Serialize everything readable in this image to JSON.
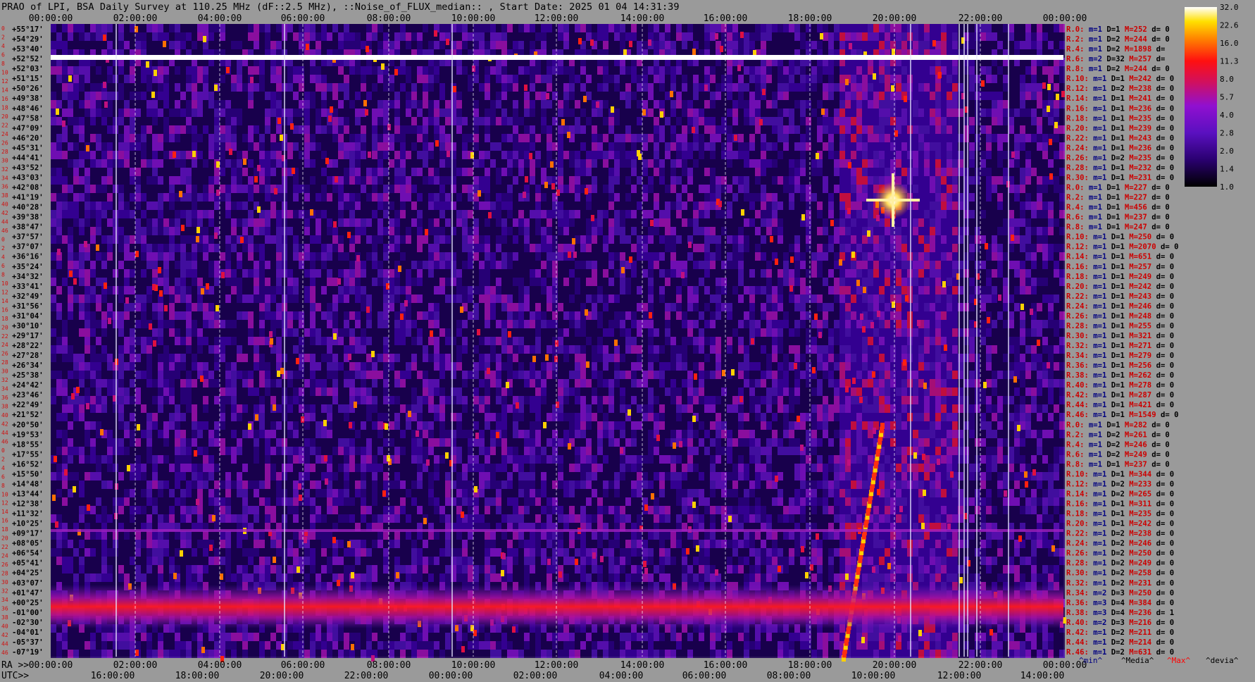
{
  "title": "PRAO of LPI, BSA Daily Survey at 110.25 MHz (dF::2.5 MHz), ::Noise_of_FLUX_median:: , Start Date: 2025 01 04 14:31:39",
  "chart_data": {
    "type": "heatmap",
    "title": "PRAO of LPI, BSA Daily Survey at 110.25 MHz (dF::2.5 MHz), ::Noise_of_FLUX_median:: , Start Date: 2025 01 04 14:31:39",
    "x_top_ticks": [
      "00:00:00",
      "02:00:00",
      "04:00:00",
      "06:00:00",
      "08:00:00",
      "10:00:00",
      "12:00:00",
      "14:00:00",
      "16:00:00",
      "18:00:00",
      "20:00:00",
      "22:00:00",
      "00:00:00"
    ],
    "x_ra_label": "RA >>",
    "x_ra_ticks": [
      "00:00:00",
      "02:00:00",
      "04:00:00",
      "06:00:00",
      "08:00:00",
      "10:00:00",
      "12:00:00",
      "14:00:00",
      "16:00:00",
      "18:00:00",
      "20:00:00",
      "22:00:00",
      "00:00:00"
    ],
    "x_utc_label": "UTC>>",
    "x_utc_ticks": [
      "16:00:00",
      "18:00:00",
      "20:00:00",
      "22:00:00",
      "00:00:00",
      "02:00:00",
      "04:00:00",
      "06:00:00",
      "08:00:00",
      "10:00:00",
      "12:00:00",
      "14:00:00"
    ],
    "row_index_labels": [
      "0",
      "2",
      "4",
      "6",
      "8",
      "10",
      "12",
      "14",
      "16",
      "18",
      "20",
      "22",
      "24",
      "26",
      "28",
      "30",
      "32",
      "34",
      "36",
      "38",
      "40",
      "42",
      "44",
      "46",
      "0",
      "2",
      "4",
      "6",
      "8",
      "10",
      "12",
      "14",
      "16",
      "18",
      "20",
      "22",
      "24",
      "26",
      "28",
      "30",
      "32",
      "34",
      "36",
      "38",
      "40",
      "42",
      "44",
      "46",
      "0",
      "2",
      "4",
      "6",
      "8",
      "10",
      "12",
      "14",
      "16",
      "18",
      "20",
      "22",
      "24",
      "26",
      "28",
      "30",
      "32",
      "34",
      "36",
      "38",
      "40",
      "42",
      "44",
      "46"
    ],
    "declination_labels": [
      "+55°17'",
      "+54°29'",
      "+53°40'",
      "+52°52'",
      "+52°03'",
      "+51°15'",
      "+50°26'",
      "+49°38'",
      "+48°46'",
      "+47°58'",
      "+47°09'",
      "+46°20'",
      "+45°31'",
      "+44°41'",
      "+43°52'",
      "+43°03'",
      "+42°08'",
      "+41°19'",
      "+40°28'",
      "+39°38'",
      "+38°47'",
      "+37°57'",
      "+37°07'",
      "+36°16'",
      "+35°24'",
      "+34°32'",
      "+33°41'",
      "+32°49'",
      "+31°56'",
      "+31°04'",
      "+30°10'",
      "+29°17'",
      "+28°22'",
      "+27°28'",
      "+26°34'",
      "+25°38'",
      "+24°42'",
      "+23°46'",
      "+22°49'",
      "+21°52'",
      "+20°50'",
      "+19°53'",
      "+18°55'",
      "+17°55'",
      "+16°52'",
      "+15°50'",
      "+14°48'",
      "+13°44'",
      "+12°38'",
      "+11°32'",
      "+10°25'",
      "+09°17'",
      "+08°05'",
      "+06°54'",
      "+05°41'",
      "+04°25'",
      "+03°07'",
      "+01°47'",
      "+00°25'",
      "-01°00'",
      "-02°30'",
      "-04°01'",
      "-05°37'",
      "-07°19'"
    ],
    "receiver_stats": [
      {
        "r": "R.0:",
        "m": "m=1",
        "D": "D=1",
        "M": "M=252",
        "d": "d= 0"
      },
      {
        "r": "R.2:",
        "m": "m=1",
        "D": "D=2",
        "M": "M=244",
        "d": "d= 0"
      },
      {
        "r": "R.4:",
        "m": "m=1",
        "D": "D=2",
        "M": "M=1898",
        "d": "d="
      },
      {
        "r": "R.6:",
        "m": "m=2",
        "D": "D=32",
        "M": "M=257",
        "d": "d="
      },
      {
        "r": "R.8:",
        "m": "m=1",
        "D": "D=2",
        "M": "M=244",
        "d": "d= 0"
      },
      {
        "r": "R.10:",
        "m": "m=1",
        "D": "D=1",
        "M": "M=242",
        "d": "d= 0"
      },
      {
        "r": "R.12:",
        "m": "m=1",
        "D": "D=2",
        "M": "M=238",
        "d": "d= 0"
      },
      {
        "r": "R.14:",
        "m": "m=1",
        "D": "D=1",
        "M": "M=241",
        "d": "d= 0"
      },
      {
        "r": "R.16:",
        "m": "m=1",
        "D": "D=1",
        "M": "M=236",
        "d": "d= 0"
      },
      {
        "r": "R.18:",
        "m": "m=1",
        "D": "D=1",
        "M": "M=235",
        "d": "d= 0"
      },
      {
        "r": "R.20:",
        "m": "m=1",
        "D": "D=1",
        "M": "M=239",
        "d": "d= 0"
      },
      {
        "r": "R.22:",
        "m": "m=1",
        "D": "D=1",
        "M": "M=243",
        "d": "d= 0"
      },
      {
        "r": "R.24:",
        "m": "m=1",
        "D": "D=1",
        "M": "M=236",
        "d": "d= 0"
      },
      {
        "r": "R.26:",
        "m": "m=1",
        "D": "D=2",
        "M": "M=235",
        "d": "d= 0"
      },
      {
        "r": "R.28:",
        "m": "m=1",
        "D": "D=1",
        "M": "M=232",
        "d": "d= 0"
      },
      {
        "r": "R.30:",
        "m": "m=1",
        "D": "D=1",
        "M": "M=231",
        "d": "d= 0"
      },
      {
        "r": "R.0:",
        "m": "m=1",
        "D": "D=1",
        "M": "M=227",
        "d": "d= 0"
      },
      {
        "r": "R.2:",
        "m": "m=1",
        "D": "D=1",
        "M": "M=227",
        "d": "d= 0"
      },
      {
        "r": "R.4:",
        "m": "m=1",
        "D": "D=1",
        "M": "M=456",
        "d": "d= 0"
      },
      {
        "r": "R.6:",
        "m": "m=1",
        "D": "D=1",
        "M": "M=237",
        "d": "d= 0"
      },
      {
        "r": "R.8:",
        "m": "m=1",
        "D": "D=1",
        "M": "M=247",
        "d": "d= 0"
      },
      {
        "r": "R.10:",
        "m": "m=1",
        "D": "D=1",
        "M": "M=250",
        "d": "d= 0"
      },
      {
        "r": "R.12:",
        "m": "m=1",
        "D": "D=1",
        "M": "M=2070",
        "d": "d= 0"
      },
      {
        "r": "R.14:",
        "m": "m=1",
        "D": "D=1",
        "M": "M=651",
        "d": "d= 0"
      },
      {
        "r": "R.16:",
        "m": "m=1",
        "D": "D=1",
        "M": "M=257",
        "d": "d= 0"
      },
      {
        "r": "R.18:",
        "m": "m=1",
        "D": "D=1",
        "M": "M=249",
        "d": "d= 0"
      },
      {
        "r": "R.20:",
        "m": "m=1",
        "D": "D=1",
        "M": "M=242",
        "d": "d= 0"
      },
      {
        "r": "R.22:",
        "m": "m=1",
        "D": "D=1",
        "M": "M=243",
        "d": "d= 0"
      },
      {
        "r": "R.24:",
        "m": "m=1",
        "D": "D=1",
        "M": "M=246",
        "d": "d= 0"
      },
      {
        "r": "R.26:",
        "m": "m=1",
        "D": "D=1",
        "M": "M=248",
        "d": "d= 0"
      },
      {
        "r": "R.28:",
        "m": "m=1",
        "D": "D=1",
        "M": "M=255",
        "d": "d= 0"
      },
      {
        "r": "R.30:",
        "m": "m=1",
        "D": "D=1",
        "M": "M=321",
        "d": "d= 0"
      },
      {
        "r": "R.32:",
        "m": "m=1",
        "D": "D=1",
        "M": "M=271",
        "d": "d= 0"
      },
      {
        "r": "R.34:",
        "m": "m=1",
        "D": "D=1",
        "M": "M=279",
        "d": "d= 0"
      },
      {
        "r": "R.36:",
        "m": "m=1",
        "D": "D=1",
        "M": "M=256",
        "d": "d= 0"
      },
      {
        "r": "R.38:",
        "m": "m=1",
        "D": "D=1",
        "M": "M=262",
        "d": "d= 0"
      },
      {
        "r": "R.40:",
        "m": "m=1",
        "D": "D=1",
        "M": "M=278",
        "d": "d= 0"
      },
      {
        "r": "R.42:",
        "m": "m=1",
        "D": "D=1",
        "M": "M=287",
        "d": "d= 0"
      },
      {
        "r": "R.44:",
        "m": "m=1",
        "D": "D=1",
        "M": "M=421",
        "d": "d= 0"
      },
      {
        "r": "R.46:",
        "m": "m=1",
        "D": "D=1",
        "M": "M=1549",
        "d": "d= 0"
      },
      {
        "r": "R.0:",
        "m": "m=1",
        "D": "D=1",
        "M": "M=282",
        "d": "d= 0"
      },
      {
        "r": "R.2:",
        "m": "m=1",
        "D": "D=2",
        "M": "M=261",
        "d": "d= 0"
      },
      {
        "r": "R.4:",
        "m": "m=1",
        "D": "D=2",
        "M": "M=246",
        "d": "d= 0"
      },
      {
        "r": "R.6:",
        "m": "m=1",
        "D": "D=2",
        "M": "M=249",
        "d": "d= 0"
      },
      {
        "r": "R.8:",
        "m": "m=1",
        "D": "D=1",
        "M": "M=237",
        "d": "d= 0"
      },
      {
        "r": "R.10:",
        "m": "m=1",
        "D": "D=1",
        "M": "M=344",
        "d": "d= 0"
      },
      {
        "r": "R.12:",
        "m": "m=1",
        "D": "D=2",
        "M": "M=233",
        "d": "d= 0"
      },
      {
        "r": "R.14:",
        "m": "m=1",
        "D": "D=2",
        "M": "M=265",
        "d": "d= 0"
      },
      {
        "r": "R.16:",
        "m": "m=1",
        "D": "D=1",
        "M": "M=311",
        "d": "d= 0"
      },
      {
        "r": "R.18:",
        "m": "m=1",
        "D": "D=1",
        "M": "M=235",
        "d": "d= 0"
      },
      {
        "r": "R.20:",
        "m": "m=1",
        "D": "D=1",
        "M": "M=242",
        "d": "d= 0"
      },
      {
        "r": "R.22:",
        "m": "m=1",
        "D": "D=2",
        "M": "M=238",
        "d": "d= 0"
      },
      {
        "r": "R.24:",
        "m": "m=1",
        "D": "D=2",
        "M": "M=246",
        "d": "d= 0"
      },
      {
        "r": "R.26:",
        "m": "m=1",
        "D": "D=2",
        "M": "M=250",
        "d": "d= 0"
      },
      {
        "r": "R.28:",
        "m": "m=1",
        "D": "D=2",
        "M": "M=249",
        "d": "d= 0"
      },
      {
        "r": "R.30:",
        "m": "m=1",
        "D": "D=2",
        "M": "M=258",
        "d": "d= 0"
      },
      {
        "r": "R.32:",
        "m": "m=1",
        "D": "D=2",
        "M": "M=231",
        "d": "d= 0"
      },
      {
        "r": "R.34:",
        "m": "m=2",
        "D": "D=3",
        "M": "M=250",
        "d": "d= 0"
      },
      {
        "r": "R.36:",
        "m": "m=3",
        "D": "D=4",
        "M": "M=384",
        "d": "d= 0"
      },
      {
        "r": "R.38:",
        "m": "m=3",
        "D": "D=4",
        "M": "M=236",
        "d": "d= 1"
      },
      {
        "r": "R.40:",
        "m": "m=2",
        "D": "D=3",
        "M": "M=216",
        "d": "d= 0"
      },
      {
        "r": "R.42:",
        "m": "m=1",
        "D": "D=2",
        "M": "M=211",
        "d": "d= 0"
      },
      {
        "r": "R.44:",
        "m": "m=1",
        "D": "D=2",
        "M": "M=214",
        "d": "d= 0"
      },
      {
        "r": "R.46:",
        "m": "m=1",
        "D": "D=2",
        "M": "M=631",
        "d": "d= 0"
      }
    ],
    "legend_keys": [
      "^min^",
      "^Media^",
      "^Max^",
      "^devia^"
    ],
    "colorbar": {
      "ticks": [
        32.0,
        22.6,
        16.0,
        11.3,
        8.0,
        5.7,
        4.0,
        2.8,
        2.0,
        1.4,
        1.0
      ],
      "tick_labels": [
        "32.0",
        "22.6",
        "16.0",
        "11.3",
        "8.0",
        "5.7",
        "4.0",
        "2.8",
        "2.0",
        "1.4",
        "1.0"
      ],
      "scale": "log2",
      "colormap": "gnuplot"
    },
    "features": {
      "saturated_row_declination": "+52°52'",
      "bright_band_declinations": [
        "+01°47'",
        "+00°25'",
        "-01°00'"
      ],
      "point_source_ra": "20:00:00",
      "point_source_dec": "+41°19'"
    }
  },
  "colors": {
    "background": "#9a9a9a",
    "plot_background": "#000040",
    "row_index_color": "#d01010",
    "receiver_label_color": "#cc0000",
    "receiver_stat_color": "#000080",
    "legend_min": "#000080",
    "legend_max": "#ff0000"
  }
}
